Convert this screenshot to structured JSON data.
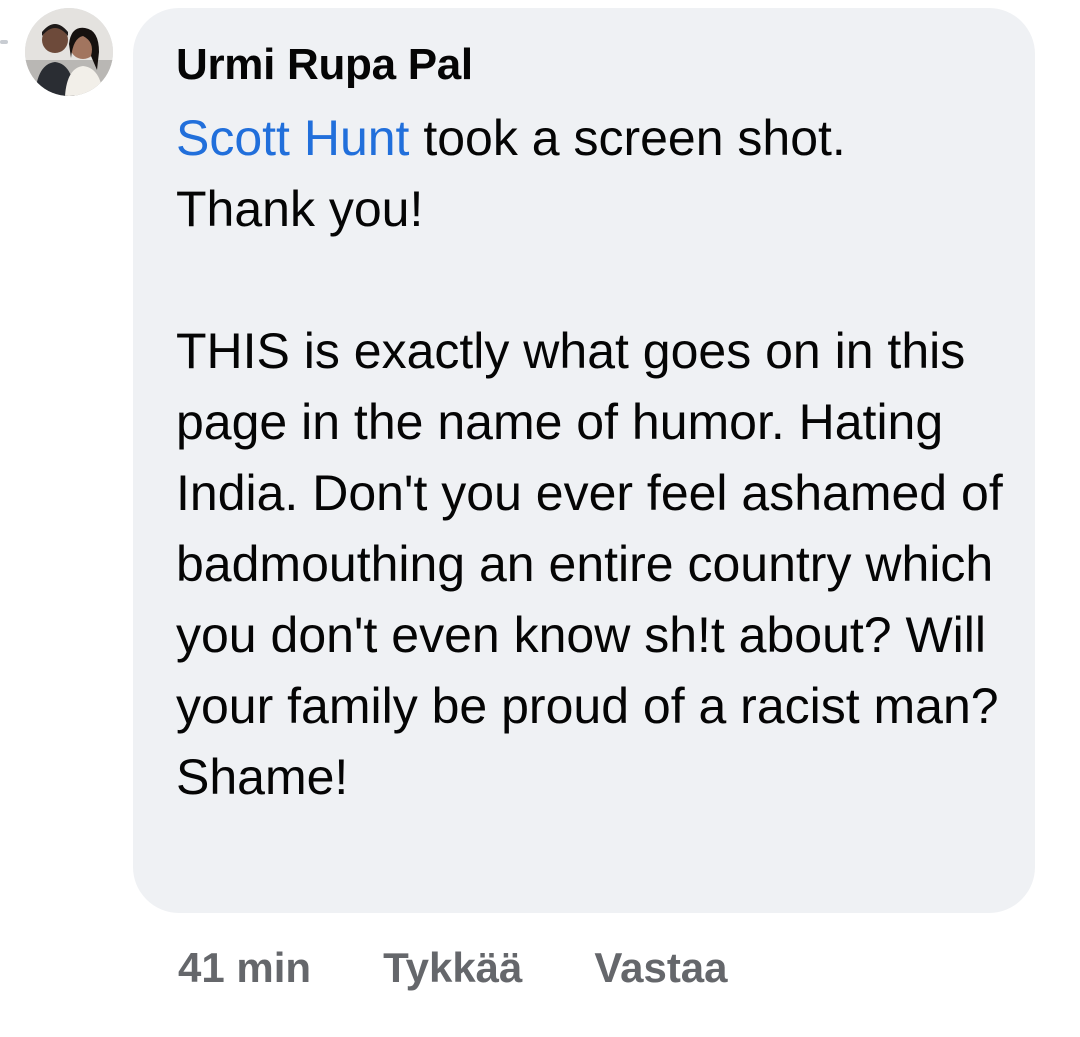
{
  "comment": {
    "author": "Urmi Rupa Pal",
    "mention": "Scott Hunt",
    "line1_rest": " took a screen shot.",
    "line2": "Thank you!",
    "paragraph2": "THIS is exactly what goes on in this page in the name of humor. Hating India. Don't you ever feel ashamed of badmouthing an entire country which you don't even know sh!t about? Will your family be proud of a racist man? Shame!",
    "time": "41 min",
    "like_label": "Tykkää",
    "reply_label": "Vastaa"
  },
  "colors": {
    "bubble_bg": "#eff1f4",
    "mention": "#216fdb",
    "meta_text": "#65676b",
    "text": "#050505"
  }
}
